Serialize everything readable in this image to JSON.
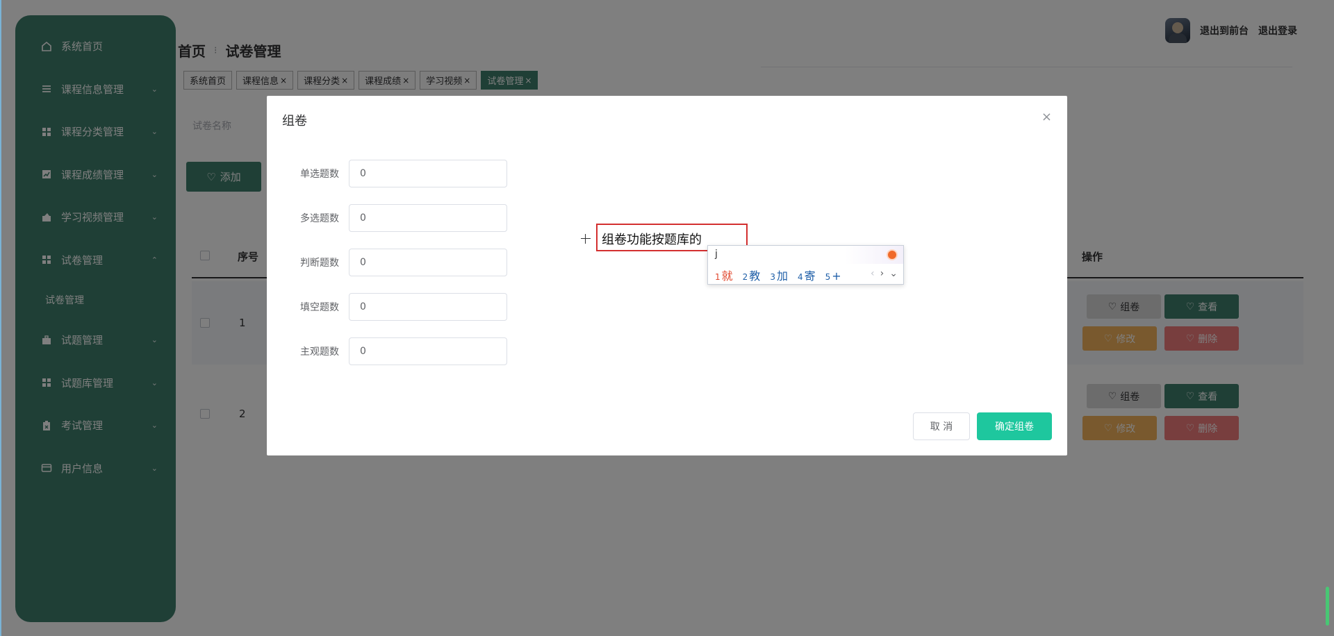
{
  "sidebar": {
    "items": [
      {
        "label": "系统首页",
        "icon": "home-icon",
        "has_chevron": false
      },
      {
        "label": "课程信息管理",
        "icon": "list-icon",
        "has_chevron": true
      },
      {
        "label": "课程分类管理",
        "icon": "grid-icon",
        "has_chevron": true
      },
      {
        "label": "课程成绩管理",
        "icon": "chart-icon",
        "has_chevron": true
      },
      {
        "label": "学习视频管理",
        "icon": "video-icon",
        "has_chevron": true
      },
      {
        "label": "试卷管理",
        "icon": "grid-icon",
        "has_chevron": true,
        "expanded": true
      }
    ],
    "submenu_label": "试卷管理",
    "items_after": [
      {
        "label": "试题管理",
        "icon": "briefcase-icon"
      },
      {
        "label": "试题库管理",
        "icon": "grid-icon"
      },
      {
        "label": "考试管理",
        "icon": "clipboard-icon"
      },
      {
        "label": "用户信息",
        "icon": "card-icon"
      }
    ],
    "chevron_down": "⌄",
    "chevron_up": "⌃"
  },
  "header": {
    "back_to_front": "退出到前台",
    "logout": "退出登录"
  },
  "breadcrumb": {
    "home": "首页",
    "current": "试卷管理"
  },
  "tags": [
    {
      "label": "系统首页",
      "closable": false,
      "active": false
    },
    {
      "label": "课程信息",
      "closable": true,
      "active": false
    },
    {
      "label": "课程分类",
      "closable": true,
      "active": false
    },
    {
      "label": "课程成绩",
      "closable": true,
      "active": false
    },
    {
      "label": "学习视频",
      "closable": true,
      "active": false
    },
    {
      "label": "试卷管理",
      "closable": true,
      "active": true
    }
  ],
  "tag_close": "×",
  "search": {
    "placeholder": "试卷名称"
  },
  "add_button": "添加",
  "table": {
    "col_index": "序号",
    "col_actions": "操作",
    "rows": [
      {
        "index": "1"
      },
      {
        "index": "2"
      }
    ],
    "actions": {
      "compose": "组卷",
      "view": "查看",
      "edit": "修改",
      "delete": "删除"
    }
  },
  "dialog": {
    "title": "组卷",
    "close": "×",
    "fields": [
      {
        "label": "单选题数",
        "value": "0"
      },
      {
        "label": "多选题数",
        "value": "0"
      },
      {
        "label": "判断题数",
        "value": "0"
      },
      {
        "label": "填空题数",
        "value": "0"
      },
      {
        "label": "主观题数",
        "value": "0"
      }
    ],
    "cancel": "取 消",
    "confirm": "确定组卷"
  },
  "annotation": {
    "text": "组卷功能按题库的"
  },
  "ime": {
    "typed": "j",
    "candidates": [
      {
        "n": "1",
        "ch": "就"
      },
      {
        "n": "2",
        "ch": "教"
      },
      {
        "n": "3",
        "ch": "加"
      },
      {
        "n": "4",
        "ch": "寄"
      },
      {
        "n": "5",
        "ch": "+"
      }
    ],
    "prev": "‹",
    "next": "›",
    "more": "⌄"
  },
  "colors": {
    "sidebar": "#3e7e6c",
    "primary": "#3e7e6c",
    "confirm": "#1ec79e",
    "orange": "#f2b25c",
    "red": "#f07c7c",
    "annotation_border": "#d32f2f"
  }
}
